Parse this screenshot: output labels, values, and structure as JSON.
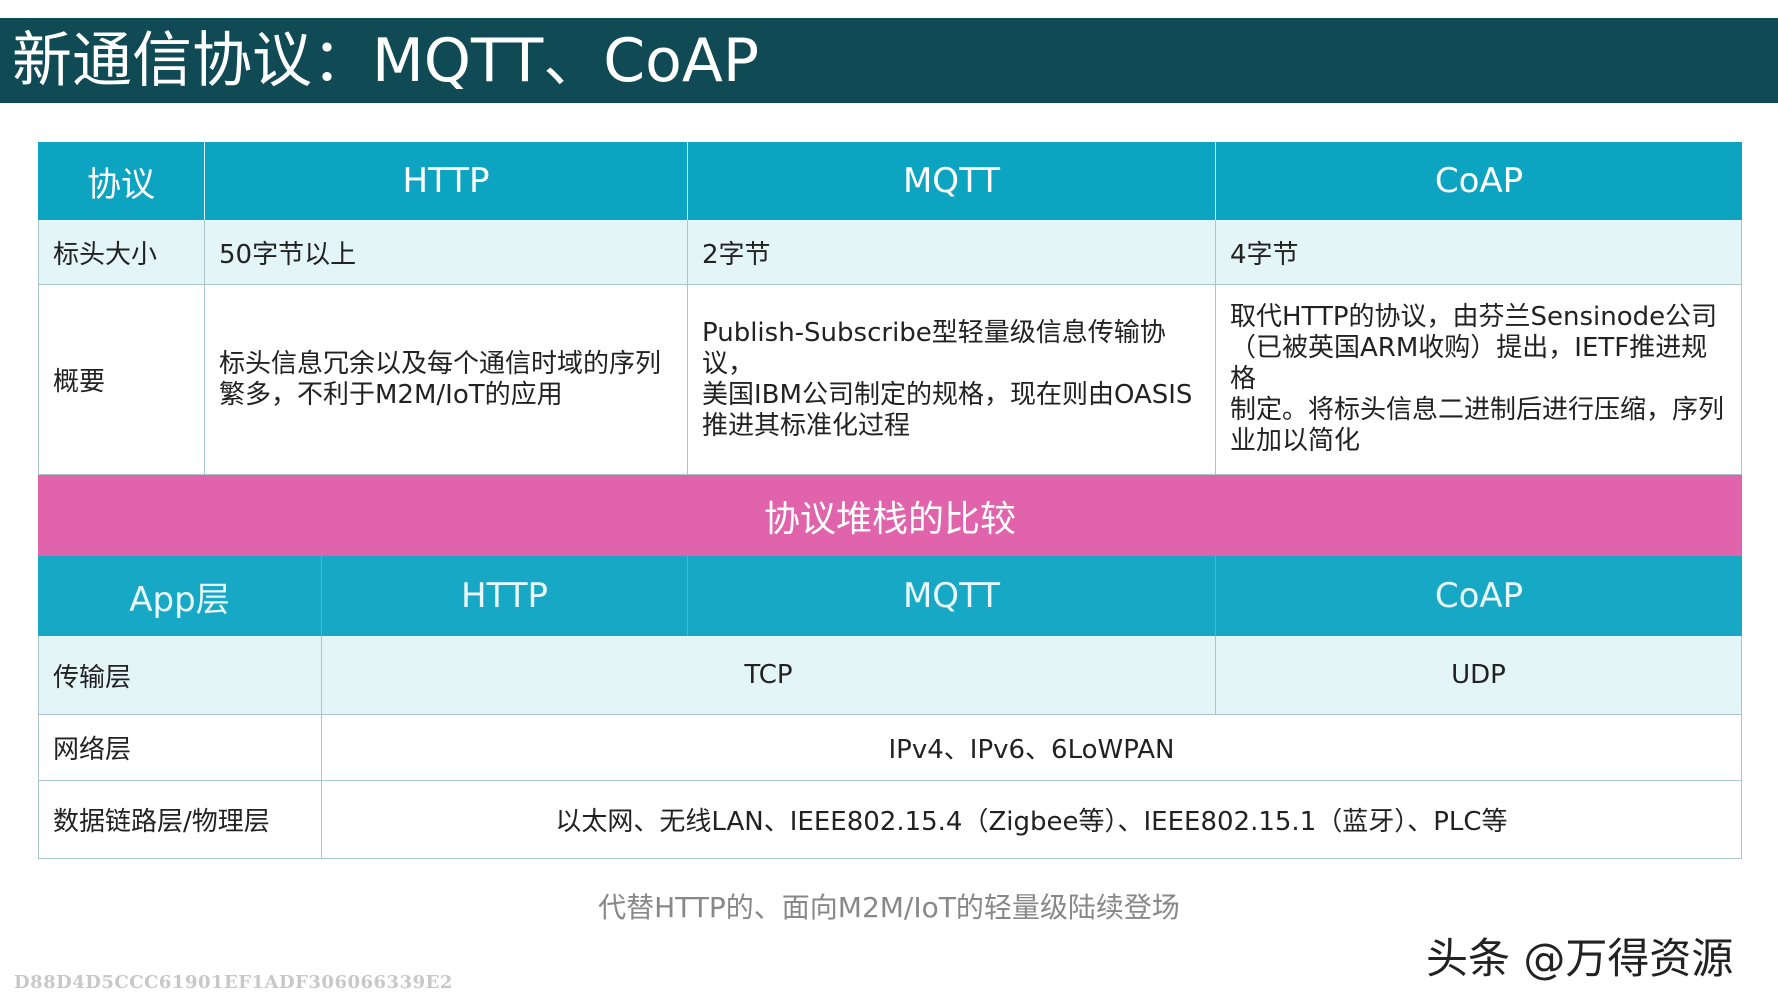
{
  "title": "新通信协议：MQTT、CoAP",
  "top_table": {
    "header": [
      "协议",
      "HTTP",
      "MQTT",
      "CoAP"
    ],
    "rows": [
      {
        "label": "标头大小",
        "http": "50字节以上",
        "mqtt": "2字节",
        "coap": "4字节"
      },
      {
        "label": "概要",
        "http": [
          "标头信息冗余以及每个通信时域的序列",
          "繁多，不利于M2M/IoT的应用"
        ],
        "mqtt": [
          "Publish-Subscribe型轻量级信息传输协议，",
          "美国IBM公司制定的规格，现在则由OASIS",
          "推进其标准化过程"
        ],
        "coap": [
          "取代HTTP的协议，由芬兰Sensinode公司",
          "（已被英国ARM收购）提出，IETF推进规格",
          "制定。将标头信息二进制后进行压缩，序列",
          "业加以简化"
        ]
      }
    ]
  },
  "stack_title": "协议堆栈的比较",
  "stack_table": {
    "header": [
      "App层",
      "HTTP",
      "MQTT",
      "CoAP"
    ],
    "rows": [
      {
        "label": "传输层",
        "tcp": "TCP",
        "udp": "UDP"
      },
      {
        "label": "网络层",
        "value": "IPv4、IPv6、6LoWPAN"
      },
      {
        "label": "数据链路层/物理层",
        "value": "以太网、无线LAN、IEEE802.15.4（Zigbee等）、IEEE802.15.1（蓝牙）、PLC等"
      }
    ]
  },
  "caption": "代替HTTP的、面向M2M/IoT的轻量级陆续登场",
  "logo": "头条 @万得资源",
  "watermark": "D88D4D5CCC61901EF1ADF306066339E2",
  "colors": {
    "title_bar": "#0f4a55",
    "header_cyan": "#0da4c2",
    "light_row": "#e4f5f8",
    "pink_band": "#e063ac"
  }
}
